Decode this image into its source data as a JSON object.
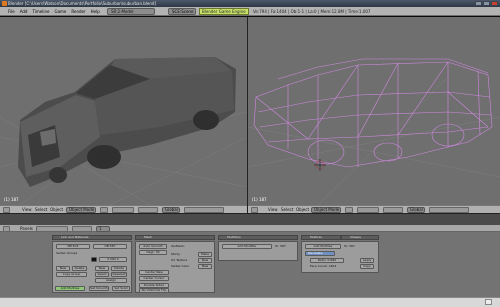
{
  "window": {
    "title": "Blender [C:\\Users\\Watson\\Documents\\Portfolio\\Suburban\\suburban.blend]"
  },
  "info_bar": {
    "menus": [
      "File",
      "Add",
      "Timeline",
      "Game",
      "Render",
      "Help"
    ],
    "screen_name": "SR:2-Model",
    "scene_name": "SCE:Scene",
    "engine_label": "Blender Game Engine",
    "stats": "Ve:794 | Fa:1404 | Ob:1-1 | La:0 | Mem:12.8M | Time:1.007"
  },
  "viewport_left": {
    "frame_label": "(1) 187",
    "header": {
      "menus": [
        "View",
        "Select",
        "Object"
      ],
      "mode": "Object Mode",
      "orientation": "Global"
    }
  },
  "viewport_right": {
    "frame_label": "(1) 187",
    "header": {
      "menus": [
        "View",
        "Select",
        "Object"
      ],
      "mode": "Object Mode",
      "orientation": "Global"
    },
    "wire_color": "#d089e0"
  },
  "buttons_window": {
    "header_label": "Panels",
    "frame_value": "1",
    "link_panel": {
      "tab": "Link and Materials",
      "me_field": "ME:Ec6",
      "ob_field": "OB:587",
      "vertex_groups_label": "Vertex Groups",
      "mat_field": "0 Mat 2",
      "buttons": [
        "New",
        "Delete",
        "Copy Group",
        "New",
        "Delete",
        "Select",
        "Deselect",
        "Assign",
        "Remove"
      ],
      "set_smooth": "Set Smooth",
      "set_solid": "Set Solid"
    },
    "mesh_panel": {
      "tab": "Mesh",
      "auto_smooth": "Auto Smooth",
      "degr": "Degr: 30",
      "texmesh": "TexMesh:",
      "sticky": "Sticky",
      "make_1": "Make",
      "uv_texture": "UV Texture",
      "new_1": "New",
      "vertex_color": "Vertex Color",
      "new_2": "New",
      "center_new": "Center New",
      "center_cursor": "Center Cursor",
      "double_sided": "Double Sided",
      "no_vnormal_flip": "No V.Normal Flip"
    },
    "modifiers_panel": {
      "tab": "Modifiers",
      "add_modifier": "Add Modifier",
      "to": "To: 587"
    },
    "multires_panel": {
      "tab": "Multires",
      "tab2": "Shapes",
      "add_multires": "Add Multires",
      "to": "To: 587",
      "decimate": "Decimate",
      "ratio": "Ratio: 0.680",
      "face_count": "Face Count: 1404",
      "apply": "Apply",
      "copy": "Copy"
    },
    "bottom_buttons": [
      "Add Multires",
      "Set Smooth",
      "Set Solid"
    ]
  }
}
